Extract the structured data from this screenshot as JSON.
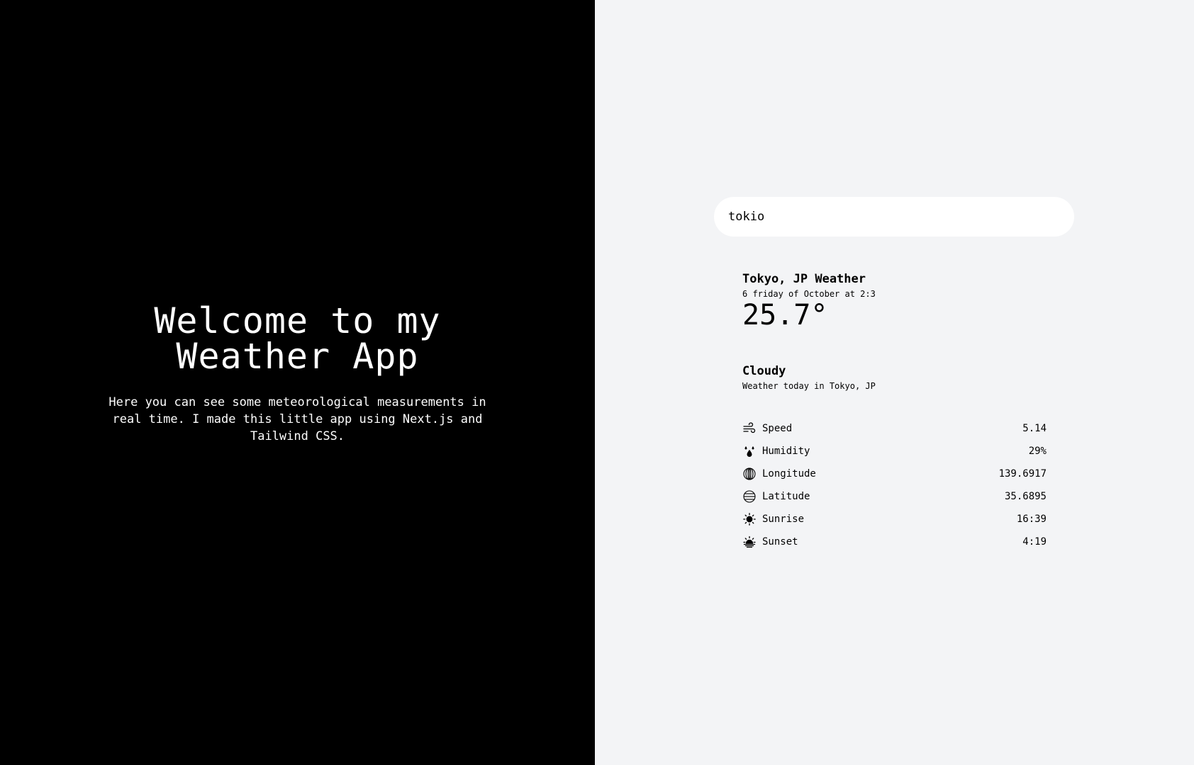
{
  "hero": {
    "title": "Welcome to my Weather App",
    "description": "Here you can see some meteorological measurements in real time. I made this little app using Next.js and Tailwind CSS."
  },
  "search": {
    "value": "tokio"
  },
  "weather": {
    "city_title": "Tokyo, JP Weather",
    "date": "6 friday of October at 2:3",
    "temperature": "25.7°",
    "condition": "Cloudy",
    "condition_sub": "Weather today in Tokyo, JP"
  },
  "stats": [
    {
      "icon": "wind-icon",
      "label": "Speed",
      "value": "5.14"
    },
    {
      "icon": "humidity-icon",
      "label": "Humidity",
      "value": "29%"
    },
    {
      "icon": "longitude-globe-icon",
      "label": "Longitude",
      "value": "139.6917"
    },
    {
      "icon": "latitude-globe-icon",
      "label": "Latitude",
      "value": "35.6895"
    },
    {
      "icon": "sun-icon",
      "label": "Sunrise",
      "value": "16:39"
    },
    {
      "icon": "sunset-icon",
      "label": "Sunset",
      "value": "4:19"
    }
  ],
  "colors": {
    "left_bg": "#000000",
    "right_bg": "#f3f4f6",
    "search_bg": "#ffffff"
  }
}
